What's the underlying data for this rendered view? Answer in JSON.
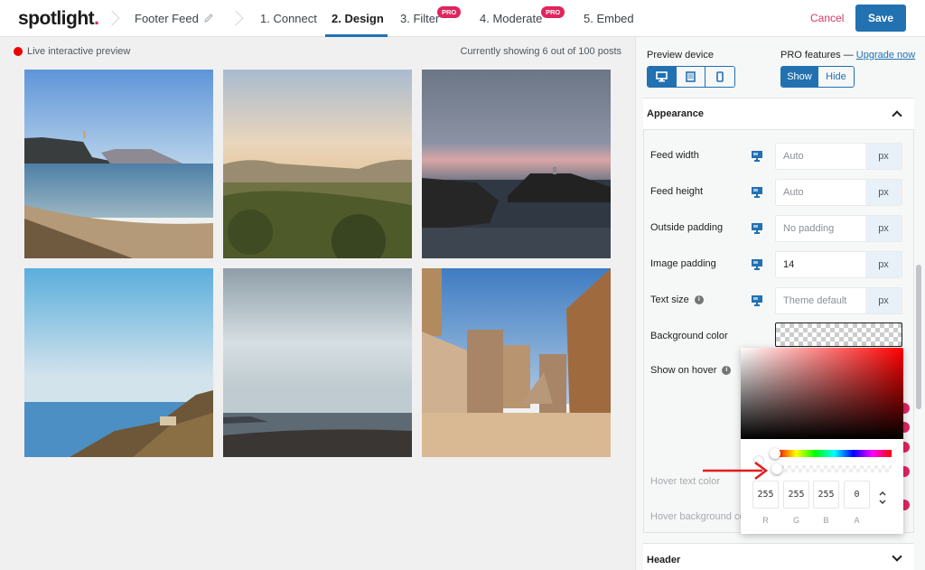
{
  "topbar": {
    "logo_text": "spotlight",
    "logo_dot": ".",
    "feed_name": "Footer Feed",
    "steps": [
      {
        "label": "1. Connect",
        "active": false,
        "pro": false
      },
      {
        "label": "2. Design",
        "active": true,
        "pro": false
      },
      {
        "label": "3. Filter",
        "active": false,
        "pro": true
      },
      {
        "label": "4. Moderate",
        "active": false,
        "pro": true
      },
      {
        "label": "5. Embed",
        "active": false,
        "pro": false
      }
    ],
    "pro_badge": "PRO",
    "cancel_label": "Cancel",
    "save_label": "Save"
  },
  "preview": {
    "live_label": "Live interactive preview",
    "showing_text": "Currently showing 6 out of 100 posts",
    "photos": [
      {
        "name": "coastal-bay-with-tower"
      },
      {
        "name": "hazy-valley-sunset"
      },
      {
        "name": "rocky-islet-at-dusk"
      },
      {
        "name": "cliffside-village-blue-sky"
      },
      {
        "name": "cloudy-harbor-view"
      },
      {
        "name": "limestone-city-gate-stairs"
      }
    ]
  },
  "sidebar": {
    "preview_device_label": "Preview device",
    "devices": [
      {
        "icon": "desktop-icon",
        "active": true
      },
      {
        "icon": "tablet-icon",
        "active": false
      },
      {
        "icon": "phone-icon",
        "active": false
      }
    ],
    "pro_features_label": "PRO features — ",
    "upgrade_link": "Upgrade now",
    "show_label": "Show",
    "hide_label": "Hide",
    "show_active": true,
    "appearance": {
      "title": "Appearance",
      "fields": [
        {
          "label": "Feed width",
          "value": "Auto",
          "placeholder": true,
          "unit": "px",
          "info": false
        },
        {
          "label": "Feed height",
          "value": "Auto",
          "placeholder": true,
          "unit": "px",
          "info": false
        },
        {
          "label": "Outside padding",
          "value": "No padding",
          "placeholder": true,
          "unit": "px",
          "info": false
        },
        {
          "label": "Image padding",
          "value": "14",
          "placeholder": false,
          "unit": "px",
          "info": false
        },
        {
          "label": "Text size",
          "value": "Theme default",
          "placeholder": true,
          "unit": "px",
          "info": true
        }
      ],
      "background_color_label": "Background color",
      "show_on_hover_label": "Show on hover",
      "hover_text_color_label": "Hover text color",
      "hover_background_label": "Hover background co"
    },
    "color_picker": {
      "r": "255",
      "g": "255",
      "b": "255",
      "a": "0",
      "labels": [
        "R",
        "G",
        "B",
        "A"
      ],
      "hue_color": "#ff0000"
    },
    "header_section_title": "Header"
  },
  "colors": {
    "accent": "#2271b1",
    "pro_badge": "#e0245e",
    "cancel": "#d63864",
    "live_dot": "#ee0000",
    "annotation_arrow": "#e31b1b"
  }
}
